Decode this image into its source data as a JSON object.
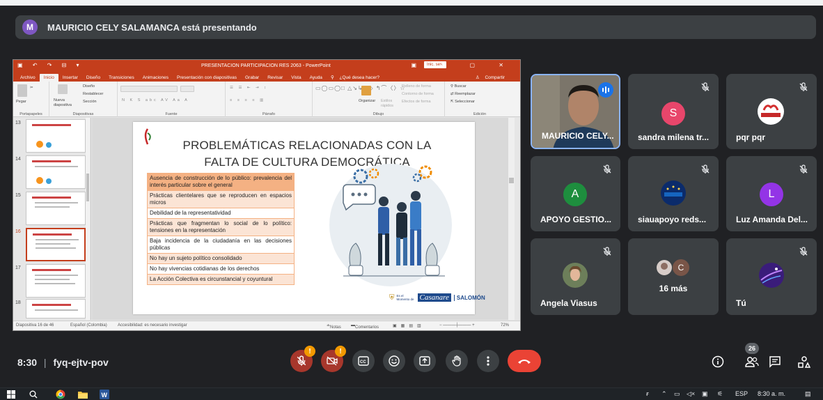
{
  "banner": {
    "avatar_letter": "M",
    "text": "MAURICIO CELY SALAMANCA está presentando"
  },
  "powerpoint": {
    "window_title": "PRESENTACION PARTICIPACION RES 2063 - PowerPoint",
    "session_button": "Inic. ses.",
    "tabs": [
      "Archivo",
      "Inicio",
      "Insertar",
      "Diseño",
      "Transiciones",
      "Animaciones",
      "Presentación con diapositivas",
      "Grabar",
      "Revisar",
      "Vista",
      "Ayuda",
      "¿Qué desea hacer?"
    ],
    "share": "Compartir",
    "ribbon": {
      "portapapeles": "Portapapeles",
      "pegar": "Pegar",
      "nueva": "Nueva diapositiva",
      "diseno": "Diseño",
      "restablecer": "Restablecer",
      "seccion": "Sección",
      "diapositivas": "Diapositivas",
      "fuente": "Fuente",
      "parrafo": "Párrafo",
      "organizar": "Organizar",
      "estilos": "Estilos rápidos",
      "relleno": "Relleno de forma",
      "contorno": "Contorno de forma",
      "efectos": "Efectos de forma",
      "dibujo": "Dibujo",
      "buscar": "Buscar",
      "reemplazar": "Reemplazar",
      "seleccionar": "Seleccionar",
      "edicion": "Edición"
    },
    "thumb_numbers": [
      "13",
      "14",
      "15",
      "16",
      "17",
      "18"
    ],
    "slide": {
      "title_line1": "PROBLEMÁTICAS RELACIONADAS CON LA",
      "title_line2": "FALTA DE CULTURA DEMOCRÁTICA",
      "rows": [
        "Ausencia de construcción de lo público: prevalencia del interés particular sobre el general",
        "Prácticas clientelares que se reproducen en espacios micros",
        "Debilidad de la representatividad",
        "Prácticas que fragmentan lo social de lo político: tensiones en la representación",
        "Baja incidencia de la ciudadanía en las decisiones públicas",
        "No hay un sujeto político consolidado",
        "No hay vivencias cotidianas de los derechos",
        "La Acción Colectiva es circunstancial y coyuntural"
      ],
      "seal_text": "Casanare",
      "seal_small": "Es el Momento de",
      "salomon": "SALOMÓN"
    },
    "status": {
      "slide_info": "Diapositiva 16 de 46",
      "language": "Español (Colombia)",
      "accessibility": "Accesibilidad: es necesario investigar",
      "notes": "Notas",
      "comments": "Comentarios",
      "zoom": "72%"
    }
  },
  "participants": [
    {
      "name": "MAURICIO CELY...",
      "type": "camera"
    },
    {
      "name": "sandra milena tr...",
      "avatar": "S",
      "color": "#e8466b",
      "muted": true
    },
    {
      "name": "pqr pqr",
      "avatar_logo": "copresoca",
      "muted": true
    },
    {
      "name": "APOYO GESTIO...",
      "avatar": "A",
      "color": "#1e8e3e",
      "muted": true
    },
    {
      "name": "siauapoyo reds...",
      "avatar_logo": "RedSalud",
      "muted": true
    },
    {
      "name": "Luz Amanda Del...",
      "avatar": "L",
      "color": "#9334e6",
      "muted": true
    },
    {
      "name": "Angela Viasus",
      "muted": true
    },
    {
      "name": "16 más",
      "avatar": "C",
      "color": "#795548"
    },
    {
      "name": "Tú",
      "muted": true
    }
  ],
  "meeting": {
    "time": "8:30",
    "separator": "|",
    "code": "fyq-ejtv-pov",
    "participant_count": "26"
  },
  "warnings": {
    "mic": "!",
    "cam": "!"
  },
  "taskbar": {
    "lang": "ESP",
    "clock": "8:30 a. m."
  }
}
